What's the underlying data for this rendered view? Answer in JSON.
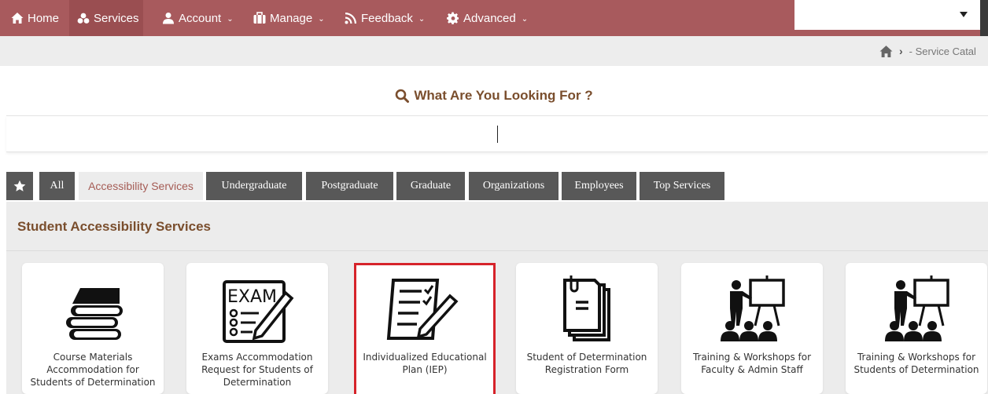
{
  "nav": {
    "items": [
      {
        "label": "Home",
        "icon": "home-icon"
      },
      {
        "label": "Services",
        "icon": "services-icon"
      },
      {
        "label": "Account",
        "icon": "user-icon"
      },
      {
        "label": "Manage",
        "icon": "briefcase-icon"
      },
      {
        "label": "Feedback",
        "icon": "rss-icon"
      },
      {
        "label": "Advanced",
        "icon": "gear-icon"
      }
    ],
    "select_value": ""
  },
  "breadcrumb": {
    "text": "- Service Catal"
  },
  "search": {
    "title": "What Are You Looking For ?",
    "value": ""
  },
  "tabs": [
    {
      "label": "All"
    },
    {
      "label": "Accessibility Services"
    },
    {
      "label": "Undergraduate"
    },
    {
      "label": "Postgraduate"
    },
    {
      "label": "Graduate"
    },
    {
      "label": "Organizations"
    },
    {
      "label": "Employees"
    },
    {
      "label": "Top Services"
    }
  ],
  "section": {
    "title": "Student Accessibility Services"
  },
  "cards": [
    {
      "label": "Course Materials Accommodation for Students of Determination",
      "icon": "books-icon"
    },
    {
      "label": "Exams Accommodation Request for Students of Determination",
      "icon": "exam-icon"
    },
    {
      "label": "Individualized Educational Plan (IEP)",
      "icon": "checklist-pen-icon"
    },
    {
      "label": "Student of Determination Registration Form",
      "icon": "documents-icon"
    },
    {
      "label": "Training & Workshops for Faculty & Admin Staff",
      "icon": "training-icon"
    },
    {
      "label": "Training & Workshops for Students of Determination",
      "icon": "training-icon"
    }
  ],
  "colors": {
    "nav": "#a85a5d",
    "accent": "#7a4e2d",
    "tab": "#585858",
    "selected_border": "#d6232a"
  }
}
